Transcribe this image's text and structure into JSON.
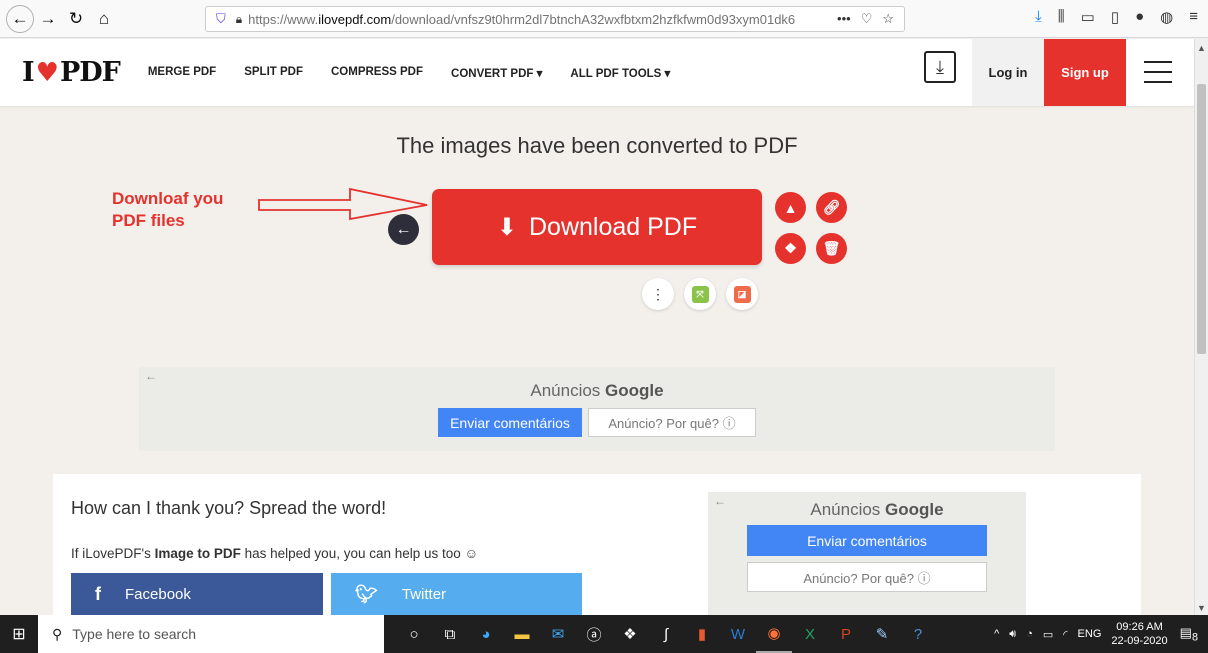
{
  "browser": {
    "url_prefix": "https://www.",
    "url_domain": "ilovepdf.com",
    "url_path": "/download/vnfsz9t0hrm2dl7btnchA32wxfbtxm2hzfkfwm0d93xym01dk6",
    "more_label": "•••"
  },
  "header": {
    "logo_left": "I",
    "logo_right": "PDF",
    "nav": [
      "MERGE PDF",
      "SPLIT PDF",
      "COMPRESS PDF",
      "CONVERT PDF ▾",
      "ALL PDF TOOLS ▾"
    ],
    "login": "Log in",
    "signup": "Sign up"
  },
  "main": {
    "title": "The images have been converted to PDF",
    "annotation_line1": "Downloaf you",
    "annotation_line2": "PDF files",
    "download_label": "Download PDF"
  },
  "ad1": {
    "title_prefix": "Anúncios ",
    "title_brand": "Google",
    "feedback": "Enviar comentários",
    "why": "Anúncio? Por quê? ⓘ"
  },
  "card": {
    "title": "How can I thank you? Spread the word!",
    "desc_prefix": "If iLovePDF's ",
    "desc_bold": "Image to PDF",
    "desc_suffix": " has helped you, you can help us too ☺",
    "facebook": "Facebook",
    "twitter": "Twitter"
  },
  "ad2": {
    "title_prefix": "Anúncios ",
    "title_brand": "Google",
    "feedback": "Enviar comentários",
    "why": "Anúncio? Por quê? ⓘ"
  },
  "taskbar": {
    "search_placeholder": "Type here to search",
    "lang": "ENG",
    "time": "09:26 AM",
    "date": "22-09-2020",
    "notif_count": "8"
  },
  "colors": {
    "brand_red": "#e5322d",
    "facebook": "#3b5998",
    "twitter": "#55acee",
    "google_blue": "#4285f4"
  }
}
